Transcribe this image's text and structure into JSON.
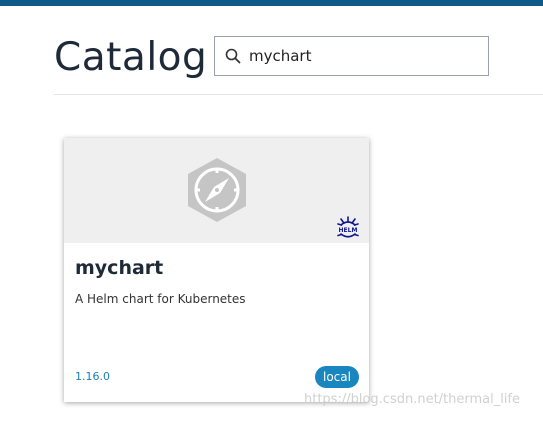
{
  "header": {
    "title": "Catalog"
  },
  "search": {
    "value": "mychart",
    "icon": "search-icon"
  },
  "card": {
    "name": "mychart",
    "description": "A Helm chart for Kubernetes",
    "version": "1.16.0",
    "repo_badge": "local",
    "logo_icon": "compass-hexagon-icon",
    "provider_icon": "helm-icon",
    "provider_label": "HELM"
  },
  "watermark": {
    "text": "https://blog.csdn.net/thermal_life"
  },
  "colors": {
    "topbar": "#0f5a86",
    "title": "#1e2a38",
    "accent": "#1a86c0",
    "card_header_bg": "#efefef",
    "helm_navy": "#0f1689"
  }
}
